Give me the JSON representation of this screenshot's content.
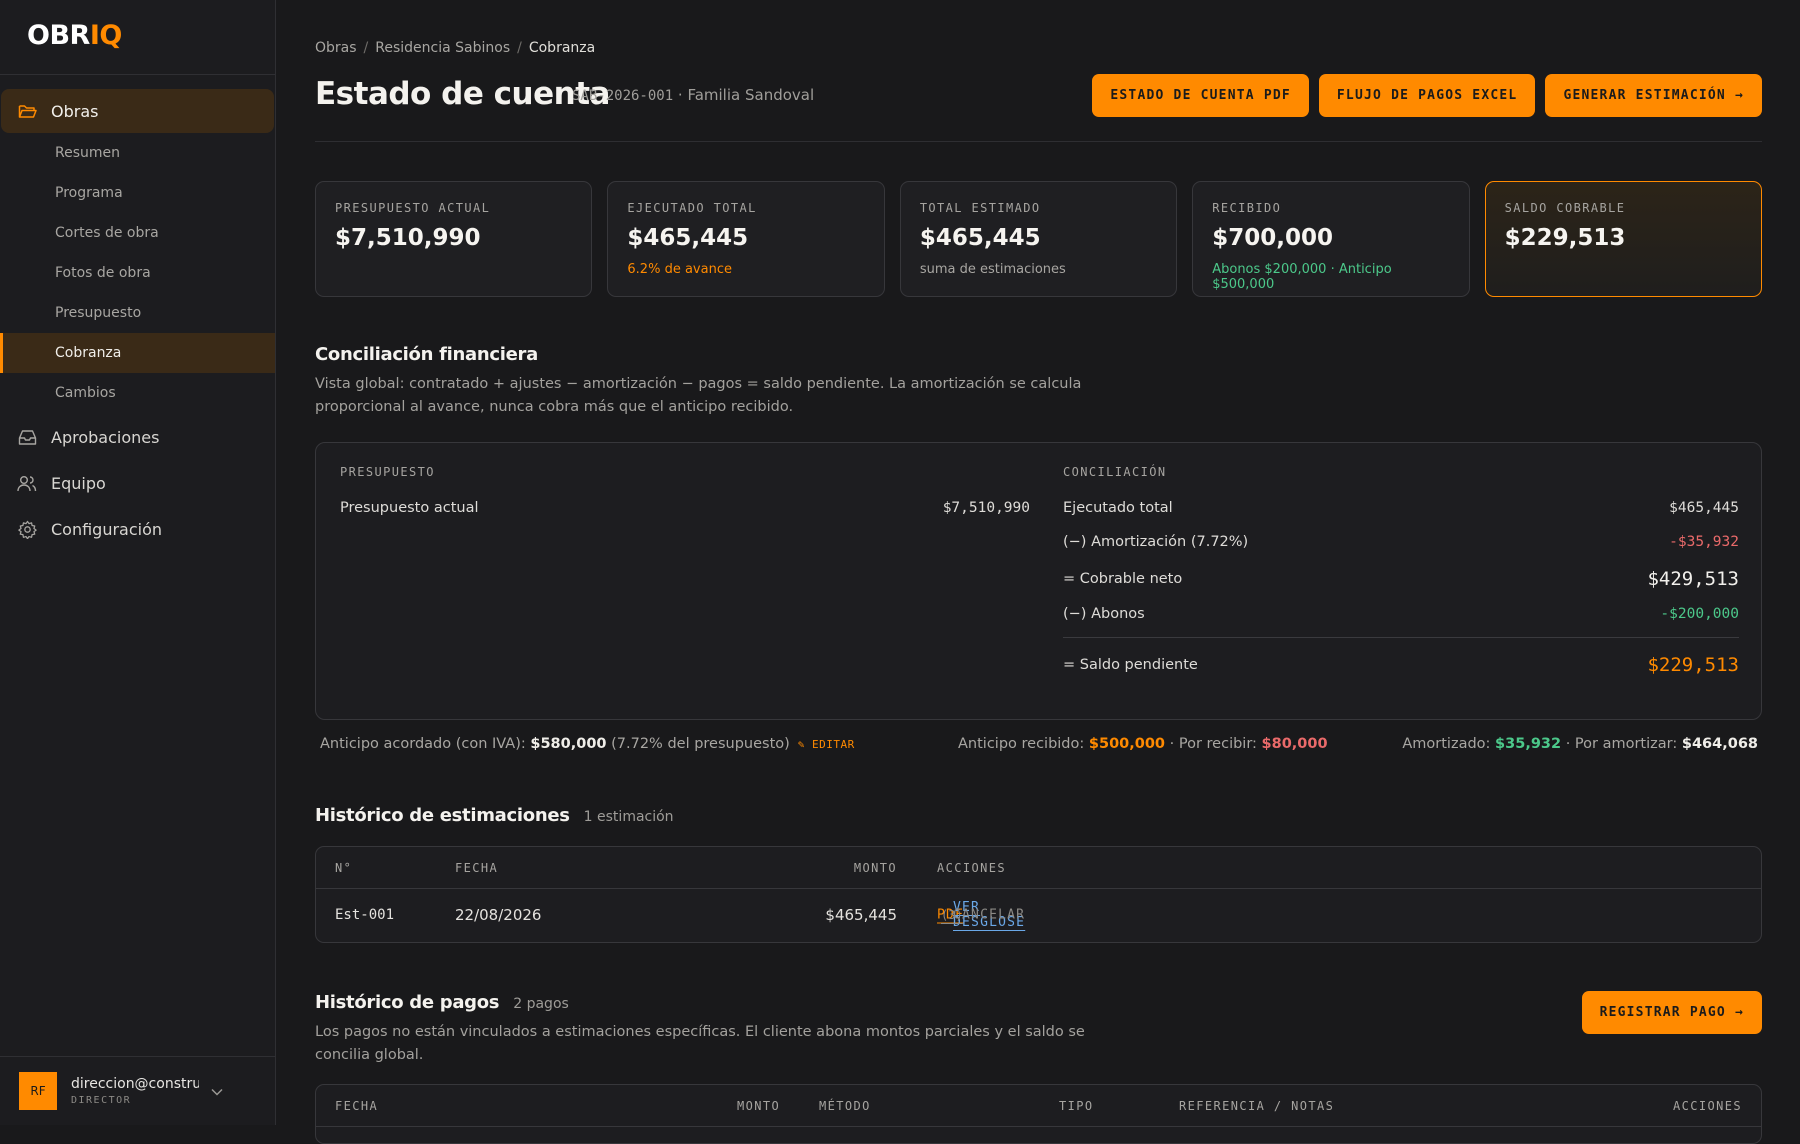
{
  "app": {
    "logo_a": "OBR",
    "logo_b": "IQ"
  },
  "sidebar": {
    "obras": "Obras",
    "sub": [
      "Resumen",
      "Programa",
      "Cortes de obra",
      "Fotos de obra",
      "Presupuesto",
      "Cobranza",
      "Cambios"
    ],
    "aprobaciones": "Aprobaciones",
    "equipo": "Equipo",
    "configuracion": "Configuración",
    "user": {
      "initials": "RF",
      "email": "direccion@constructo...",
      "role": "DIRECTOR"
    }
  },
  "breadcrumb": [
    "Obras",
    "Residencia Sabinos",
    "Cobranza"
  ],
  "header": {
    "title": "Estado de cuenta",
    "subtitle_code": "SAB-2026-001",
    "subtitle_rest": " · Familia Sandoval",
    "btn_pdf": "ESTADO DE CUENTA PDF",
    "btn_excel": "FLUJO DE PAGOS EXCEL",
    "btn_gen": "GENERAR ESTIMACIÓN →"
  },
  "kpis": [
    {
      "label": "PRESUPUESTO ACTUAL",
      "value": "$7,510,990",
      "note": ""
    },
    {
      "label": "EJECUTADO TOTAL",
      "value": "$465,445",
      "note": "6.2% de avance"
    },
    {
      "label": "TOTAL ESTIMADO",
      "value": "$465,445",
      "note": "suma de estimaciones"
    },
    {
      "label": "RECIBIDO",
      "value": "$700,000",
      "note": "Abonos $200,000 · Anticipo $500,000"
    },
    {
      "label": "SALDO COBRABLE",
      "value": "$229,513",
      "note": ""
    }
  ],
  "conciliacion": {
    "title": "Conciliación financiera",
    "desc": "Vista global: contratado + ajustes − amortización − pagos = saldo pendiente. La amortización se calcula proporcional al avance, nunca cobra más que el anticipo recibido.",
    "left_label": "PRESUPUESTO",
    "left_row_label": "Presupuesto actual",
    "left_row_value": "$7,510,990",
    "right_label": "CONCILIACIÓN",
    "rows": [
      {
        "label": "Ejecutado total",
        "value": "$465,445"
      },
      {
        "label": "(−) Amortización (7.72%)",
        "value": "-$35,932"
      },
      {
        "label": "= Cobrable neto",
        "value": "$429,513"
      },
      {
        "label": "(−) Abonos",
        "value": "-$200,000"
      },
      {
        "label": "= Saldo pendiente",
        "value": "$229,513"
      }
    ]
  },
  "anticipo": {
    "a_label": "Anticipo acordado (con IVA): ",
    "a_value": "$580,000",
    "a_pct": " (7.72% del presupuesto)",
    "editar": "✎ EDITAR",
    "b_label": "Anticipo recibido: ",
    "b_value": "$500,000",
    "b_mid": " · Por recibir: ",
    "b_value2": "$80,000",
    "c_label": "Amortizado: ",
    "c_value": "$35,932",
    "c_mid": " · Por amortizar: ",
    "c_value2": "$464,068"
  },
  "estimaciones": {
    "title": "Histórico de estimaciones",
    "count": "1 estimación",
    "headers": [
      "N°",
      "FECHA",
      "MONTO",
      "ACCIONES"
    ],
    "rows": [
      {
        "num": "Est-001",
        "fecha": "22/08/2026",
        "monto": "$465,445",
        "pdf": "PDF",
        "ver": "VER DESGLOSE",
        "ver_count": "(3)",
        "cancelar": "CANCELAR"
      }
    ]
  },
  "pagos": {
    "title": "Histórico de pagos",
    "count": "2 pagos",
    "desc": "Los pagos no están vinculados a estimaciones específicas. El cliente abona montos parciales y el saldo se concilia global.",
    "btn": "REGISTRAR PAGO →",
    "headers": [
      "FECHA",
      "MONTO",
      "MÉTODO",
      "TIPO",
      "REFERENCIA / NOTAS",
      "ACCIONES"
    ]
  },
  "colors": {
    "accent": "#ff8a00",
    "negative": "#ea6a6a",
    "positive": "#4cc88a",
    "link": "#6aa8e8"
  }
}
